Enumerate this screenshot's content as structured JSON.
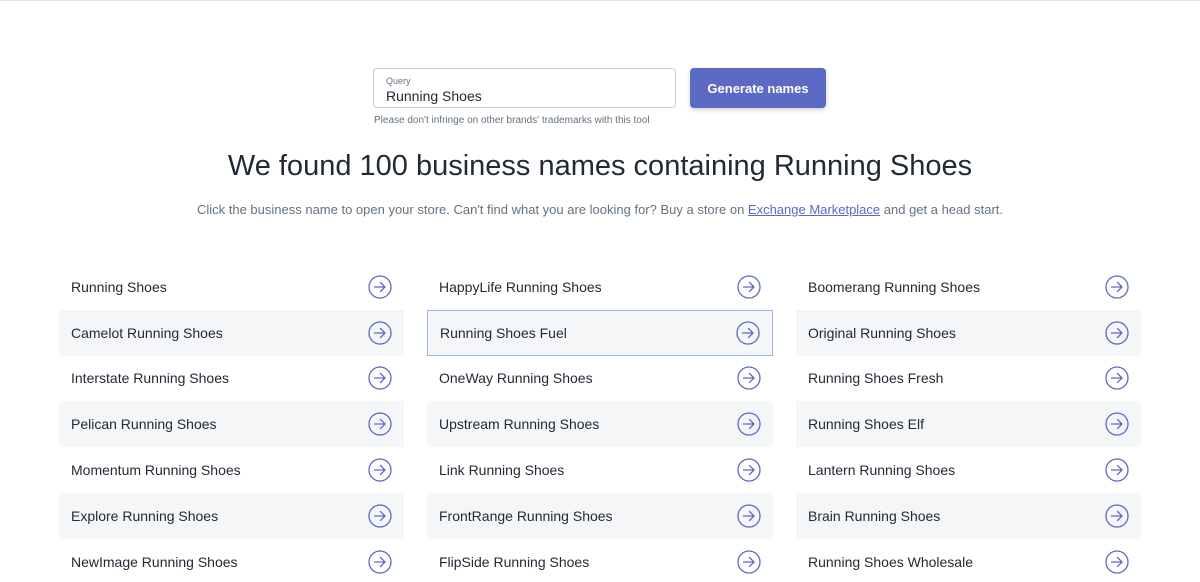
{
  "search": {
    "label": "Query",
    "value": "Running Shoes",
    "button_label": "Generate names",
    "hint": "Please don't infringe on other brands' trademarks with this tool"
  },
  "results": {
    "headline": "We found 100 business names containing Running Shoes",
    "sub_before": "Click the business name to open your store. Can't find what you are looking for? Buy a store on ",
    "sub_link": "Exchange Marketplace",
    "sub_after": " and get a head start."
  },
  "colors": {
    "accent": "#5c6ac4",
    "row_shade": "#f4f6f8",
    "active_border": "#9bb6e8"
  },
  "names": {
    "columns": [
      [
        "Running Shoes",
        "Camelot Running Shoes",
        "Interstate Running Shoes",
        "Pelican Running Shoes",
        "Momentum Running Shoes",
        "Explore Running Shoes",
        "NewImage Running Shoes"
      ],
      [
        "HappyLife Running Shoes",
        "Running Shoes Fuel",
        "OneWay Running Shoes",
        "Upstream Running Shoes",
        "Link Running Shoes",
        "FrontRange Running Shoes",
        "FlipSide Running Shoes"
      ],
      [
        "Boomerang Running Shoes",
        "Original Running Shoes",
        "Running Shoes Fresh",
        "Running Shoes Elf",
        "Lantern Running Shoes",
        "Brain Running Shoes",
        "Running Shoes Wholesale"
      ]
    ],
    "active": "Running Shoes Fuel",
    "row_icon": "arrow-circle-right-icon"
  }
}
